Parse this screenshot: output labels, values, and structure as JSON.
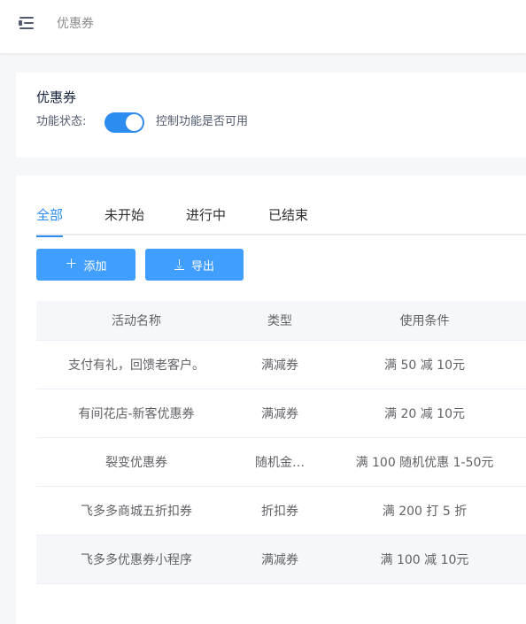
{
  "header": {
    "menu_icon": "menu-fold-icon",
    "breadcrumb": "优惠券"
  },
  "status_card": {
    "title": "优惠券",
    "status_label": "功能状态:",
    "switch_on": true,
    "switch_desc": "控制功能是否可用",
    "accent": "#2d8cf0"
  },
  "tabs": [
    {
      "label": "全部",
      "active": true
    },
    {
      "label": "未开始",
      "active": false
    },
    {
      "label": "进行中",
      "active": false
    },
    {
      "label": "已结束",
      "active": false
    }
  ],
  "toolbar": {
    "add_label": "添加",
    "add_icon": "plus-icon",
    "export_label": "导出",
    "export_icon": "download-icon",
    "button_color": "#409eff"
  },
  "table": {
    "columns": [
      "活动名称",
      "类型",
      "使用条件"
    ],
    "rows": [
      {
        "name": "支付有礼，回馈老客户。",
        "type": "满减券",
        "condition": "满 50 减 10元"
      },
      {
        "name": "有间花店-新客优惠券",
        "type": "满减券",
        "condition": "满 20 减 10元"
      },
      {
        "name": "裂变优惠券",
        "type": "随机金…",
        "condition": "满 100 随机优惠 1-50元"
      },
      {
        "name": "飞多多商城五折扣券",
        "type": "折扣券",
        "condition": "满 200 打 5 折"
      },
      {
        "name": "飞多多优惠券小程序",
        "type": "满减券",
        "condition": "满 100 减 10元"
      }
    ]
  }
}
